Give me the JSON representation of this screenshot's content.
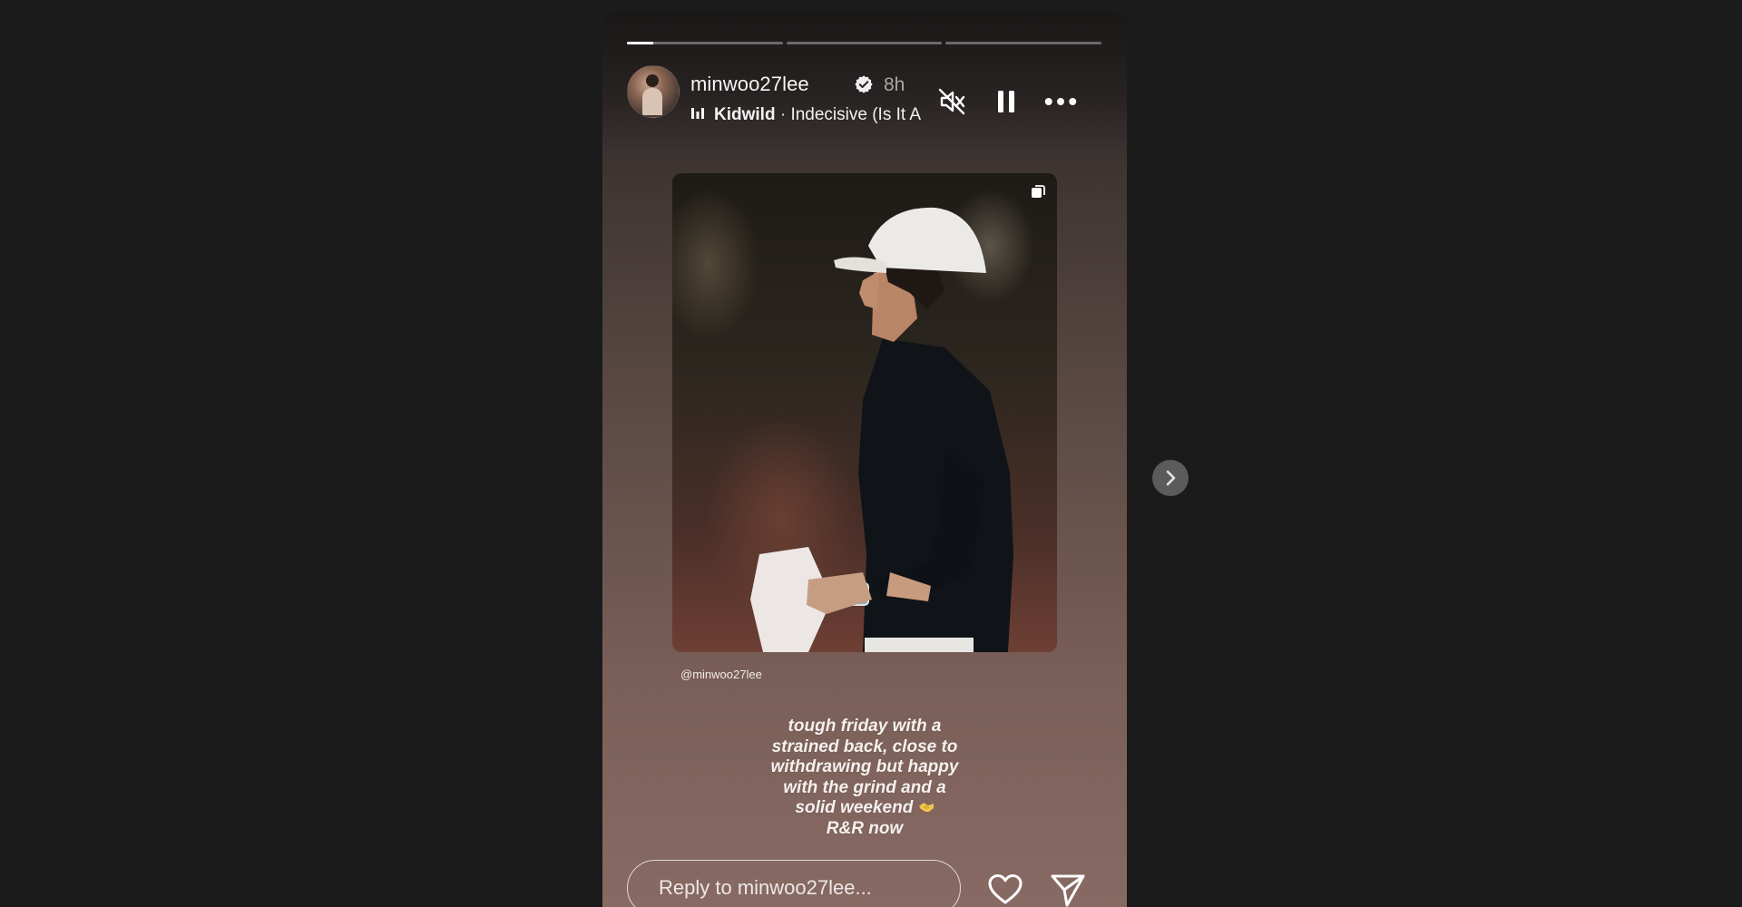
{
  "story": {
    "progress": {
      "segments": [
        {
          "fill": 0.17
        },
        {
          "fill": 0
        },
        {
          "fill": 0
        }
      ]
    },
    "header": {
      "username": "minwoo27lee",
      "verified": true,
      "time_ago": "8h",
      "music": {
        "artist": "Kidwild",
        "separator": " · ",
        "track": "Indecisive (Is It A"
      }
    },
    "controls": {
      "mute_icon": "speaker-muted-icon",
      "pause_icon": "pause-icon",
      "more_icon": "more-options-icon"
    },
    "post": {
      "carousel_icon": "carousel-icon",
      "image_description_icon": "golfer-photo"
    },
    "mention": "@minwoo27lee",
    "caption": {
      "text": "tough friday with a\nstrained back, close to\nwithdrawing but happy\nwith the grind and a\nsolid weekend",
      "emoji": "handshake",
      "last_line": "R&R now"
    },
    "reply": {
      "placeholder": "Reply to minwoo27lee..."
    }
  },
  "navigation": {
    "next_icon": "chevron-right-icon"
  },
  "colors": {
    "background": "#1b1b1b",
    "story_gradient_top": "#2a2524",
    "story_gradient_bottom": "#876a63",
    "text": "#f5f5f5"
  }
}
